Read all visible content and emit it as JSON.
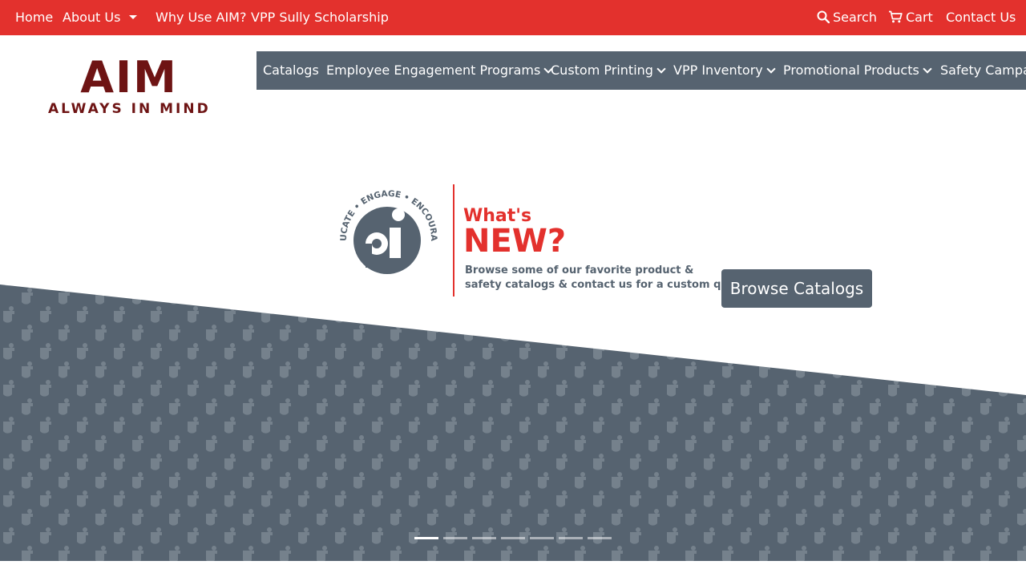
{
  "topbar": {
    "home": "Home",
    "about": "About Us",
    "why": "Why Use AIM?",
    "scholarship": "VPP Sully Scholarship",
    "search": "Search",
    "cart": "Cart",
    "contact": "Contact Us"
  },
  "logo": {
    "big": "AIM",
    "small": "ALWAYS IN MIND"
  },
  "mainnav": {
    "items": [
      "Catalogs",
      "Employee Engagement Programs",
      "Custom Printing",
      "VPP Inventory",
      "Promotional Products",
      "Safety Campai"
    ]
  },
  "hero": {
    "arc_text": "EDUCATE • ENGAGE • ENCOURAGE",
    "title1": "What's",
    "title2": "NEW?",
    "body1": "Browse some of our favorite product &",
    "body2": "safety catalogs & contact us for a custom quote",
    "button": "Browse Catalogs",
    "slide_count": 7,
    "active_slide": 1
  },
  "colors": {
    "brand_red": "#e3312d",
    "logo_maroon": "#6e1414",
    "slate": "#566370"
  },
  "icons": [
    "search-icon",
    "cart-icon",
    "caret-down-icon",
    "chevron-down-icon"
  ]
}
